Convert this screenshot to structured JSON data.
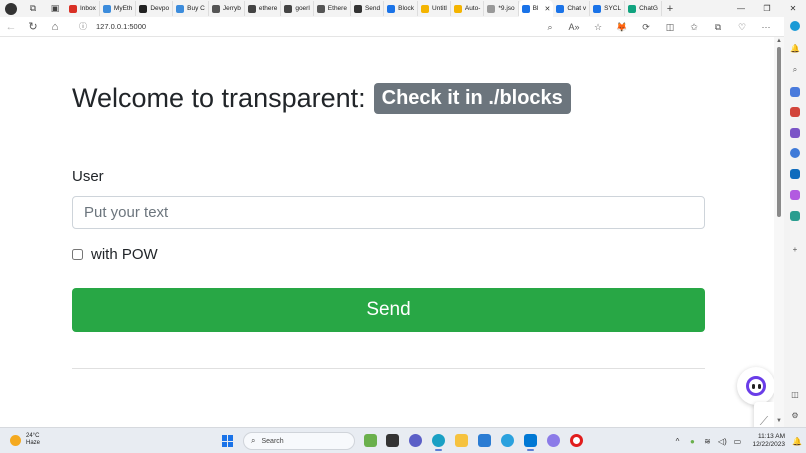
{
  "browser": {
    "tabs": [
      {
        "label": "Inbox",
        "color": "#d93025"
      },
      {
        "label": "MyEth",
        "color": "#3c8cdc"
      },
      {
        "label": "Devpo",
        "color": "#222222"
      },
      {
        "label": "Buy C",
        "color": "#3c8cdc"
      },
      {
        "label": "Jerryb",
        "color": "#555555"
      },
      {
        "label": "ethere",
        "color": "#444444"
      },
      {
        "label": "goerl",
        "color": "#444444"
      },
      {
        "label": "Ethere",
        "color": "#555555"
      },
      {
        "label": "Send",
        "color": "#333333"
      },
      {
        "label": "Block",
        "color": "#1a73e8"
      },
      {
        "label": "Untitl",
        "color": "#f4b400"
      },
      {
        "label": "Auto-",
        "color": "#f4b400"
      },
      {
        "label": "*9.jso",
        "color": "#999999"
      },
      {
        "label": "Bl",
        "color": "#1a73e8"
      },
      {
        "label": "Chat v",
        "color": "#1a73e8"
      },
      {
        "label": "SYCL",
        "color": "#1a73e8"
      },
      {
        "label": "ChatG",
        "color": "#10a37f"
      }
    ],
    "active_tab_index": 13,
    "address": "127.0.0.1:5000"
  },
  "page": {
    "title": "Welcome to transparent:",
    "badge": "Check it in ./blocks",
    "user_label": "User",
    "input_placeholder": "Put your text",
    "input_value": "",
    "pow_label": "with POW",
    "pow_checked": false,
    "send_label": "Send"
  },
  "taskbar": {
    "weather_temp": "24°C",
    "weather_desc": "Haze",
    "search_label": "Search",
    "time": "11:13 AM",
    "date": "12/22/2023"
  },
  "colors": {
    "send_button": "#28a745",
    "badge": "#6c757d"
  }
}
